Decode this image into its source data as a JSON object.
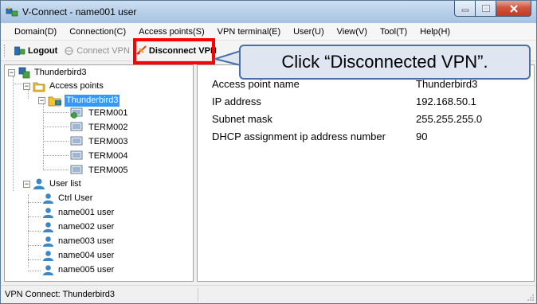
{
  "window": {
    "title": "V-Connect - name001 user"
  },
  "menubar": {
    "items": [
      {
        "label": "Domain(D)"
      },
      {
        "label": "Connection(C)"
      },
      {
        "label": "Access points(S)"
      },
      {
        "label": "VPN terminal(E)"
      },
      {
        "label": "User(U)"
      },
      {
        "label": "View(V)"
      },
      {
        "label": "Tool(T)"
      },
      {
        "label": "Help(H)"
      }
    ]
  },
  "toolbar": {
    "logout_label": "Logout",
    "connect_vpn_label": "Connect VPN",
    "disconnect_vpn_label": "Disconnect VPN"
  },
  "tree": {
    "root": "Thunderbird3",
    "access_points_label": "Access points",
    "selected_ap": "Thunderbird3",
    "terminals": [
      "TERM001",
      "TERM002",
      "TERM003",
      "TERM004",
      "TERM005"
    ],
    "user_list_label": "User list",
    "users": [
      "Ctrl User",
      "name001 user",
      "name002 user",
      "name003 user",
      "name004 user",
      "name005 user"
    ]
  },
  "details": {
    "rows": [
      {
        "key": "Access point name",
        "value": "Thunderbird3"
      },
      {
        "key": "IP address",
        "value": "192.168.50.1"
      },
      {
        "key": "Subnet mask",
        "value": "255.255.255.0"
      },
      {
        "key": "DHCP assignment ip address number",
        "value": "90"
      }
    ]
  },
  "statusbar": {
    "text": "VPN Connect: Thunderbird3"
  },
  "annotation": {
    "callout_text": "Click “Disconnected VPN”.",
    "highlight_color": "#ff0000",
    "callout_border": "#4a6fa5",
    "callout_fill": "#dfe6f1"
  },
  "colors": {
    "selection": "#3399ff",
    "titlebar": "#b9d1ea",
    "close_button": "#c13a25"
  }
}
